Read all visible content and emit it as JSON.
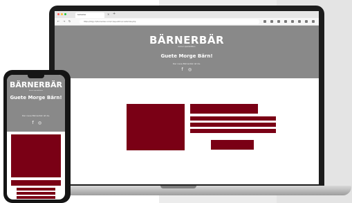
{
  "browser": {
    "tab_title": "berberbar",
    "tab_close": "×",
    "tab_new": "+",
    "url": "https://bilgi.ch/barnerbar.com/rc/wp-admin/customize.php"
  },
  "site": {
    "logo": "BÄRNERBÄR",
    "logo_subtitle": "berner spezialitäten",
    "greeting": "Guete Morge Bärn!",
    "tagline": "Der neue Bärnerbär ist da.",
    "accent": "#7a0015",
    "header_bg": "#898989",
    "social_icons": [
      "facebook-icon",
      "instagram-icon"
    ]
  },
  "phone": {
    "greeting": "Guete Morge Bärn!",
    "tagline": "Der neue Bärnerbär ist da."
  },
  "icons": {
    "facebook": "f",
    "instagram": "◎",
    "back": "←",
    "forward": "→",
    "reload": "↻"
  }
}
